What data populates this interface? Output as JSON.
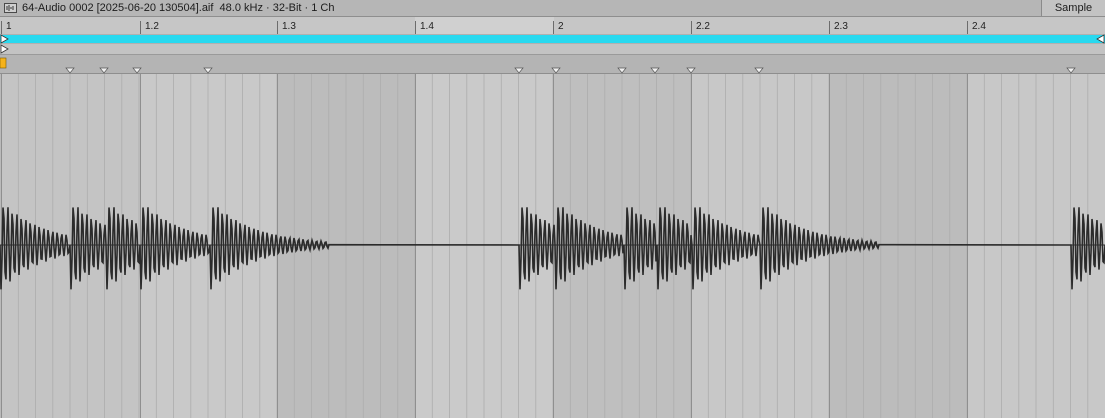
{
  "header": {
    "title": "64-Audio 0002 [2025-06-20 130504].aif  48.0 kHz · 32-Bit · 1 Ch",
    "sample_label": "Sample"
  },
  "ruler": {
    "labels": [
      "1",
      "1.2",
      "1.3",
      "1.4",
      "2",
      "2.2",
      "2.3",
      "2.4"
    ]
  },
  "colors": {
    "loop_brace": "#28d9ef",
    "start_marker": "#f5b21a",
    "waveform": "#2b2b2b"
  },
  "icons": {
    "file": "audio-file-icon",
    "loop_start": "loop-start-marker-icon",
    "loop_end": "loop-end-marker-icon",
    "start": "start-marker-icon",
    "warp": "warp-marker-icon"
  }
}
